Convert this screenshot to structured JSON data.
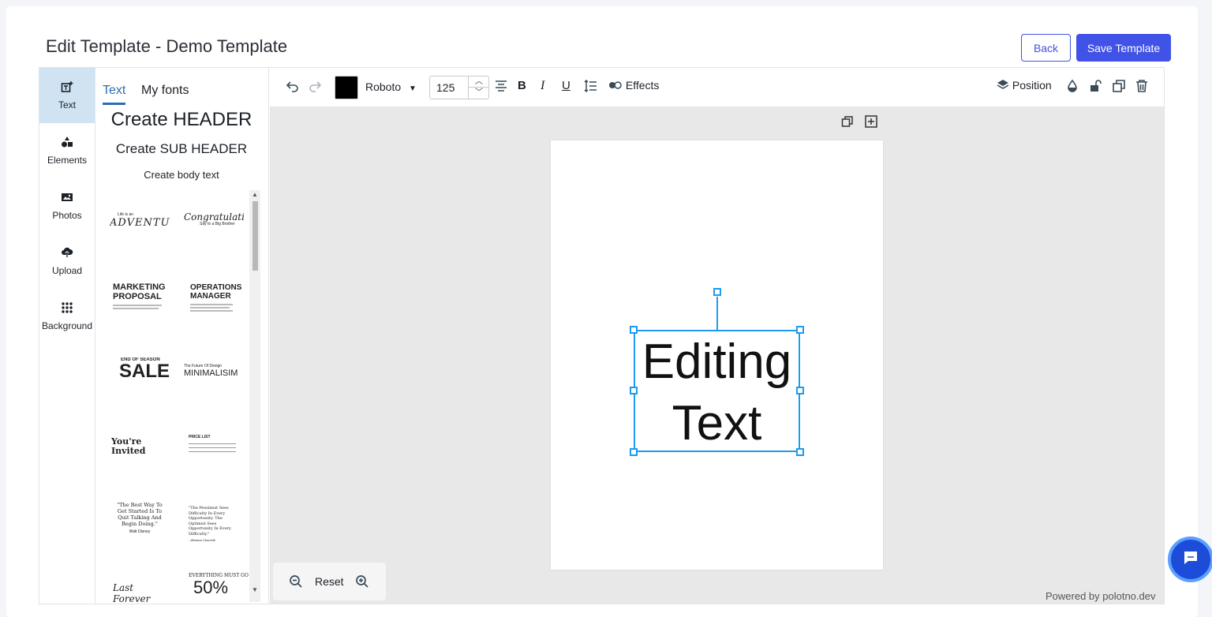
{
  "header": {
    "title": "Edit Template - Demo Template",
    "back_label": "Back",
    "save_label": "Save Template"
  },
  "side_tabs": [
    {
      "label": "Text",
      "icon": "text-add-icon"
    },
    {
      "label": "Elements",
      "icon": "shapes-icon"
    },
    {
      "label": "Photos",
      "icon": "image-icon"
    },
    {
      "label": "Upload",
      "icon": "cloud-upload-icon"
    },
    {
      "label": "Background",
      "icon": "dots-grid-icon"
    }
  ],
  "panel": {
    "tabs": [
      "Text",
      "My fonts"
    ],
    "create_header": "Create HEADER",
    "create_subheader": "Create SUB HEADER",
    "create_body": "Create body text",
    "templates": [
      {
        "small": "Life is an",
        "big": "ADVENTURE"
      },
      {
        "small": "Say to a Big Brother",
        "big": "Congratulations!"
      },
      {
        "small": "MARKETING",
        "big": "PROPOSAL"
      },
      {
        "small": "OPERATIONS",
        "big": "MANAGER"
      },
      {
        "small": "END OF SEASON",
        "big": "SALE"
      },
      {
        "small": "The Future Of Design",
        "big": "MINIMALISIM"
      },
      {
        "small": "You're",
        "big": "Invited"
      },
      {
        "small": "PRICE LIST",
        "big": ""
      },
      {
        "small": "\"The Best Way To Get Started Is To Quit Talking And Begin Doing.\"",
        "big": "Walt Disney"
      },
      {
        "small": "\"The Pessimist Sees Difficulty In Every Opportunity. The Optimist Sees Opportunity In Every Difficulty.\"",
        "big": "- Winston Churchill"
      },
      {
        "small": "Last Forever",
        "big": ""
      },
      {
        "small": "EVERYTHING MUST GO",
        "big": "50%"
      }
    ]
  },
  "toolbar": {
    "font_family": "Roboto",
    "font_size": "125",
    "color": "#000000",
    "effects_label": "Effects",
    "position_label": "Position"
  },
  "canvas": {
    "text_line1": "Editing",
    "text_line2": "Text",
    "zoom_reset_label": "Reset",
    "powered_by": "Powered by polotno.dev"
  }
}
